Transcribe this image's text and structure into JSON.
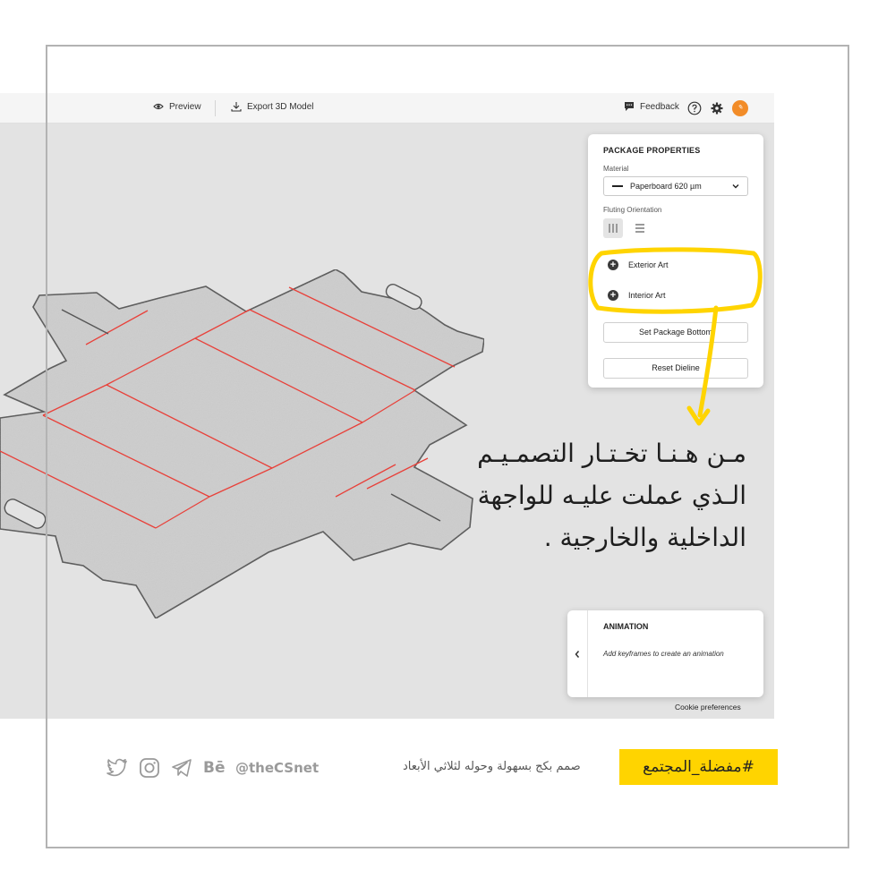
{
  "toolbar": {
    "preview_label": "Preview",
    "export_label": "Export 3D Model",
    "feedback_label": "Feedback"
  },
  "package_properties": {
    "title": "PACKAGE PROPERTIES",
    "material_label": "Material",
    "material_value": "Paperboard 620 µm",
    "fluting_label": "Fluting Orientation",
    "exterior_art_label": "Exterior Art",
    "interior_art_label": "Interior Art",
    "set_bottom_label": "Set Package Bottom",
    "reset_dieline_label": "Reset Dieline"
  },
  "animation": {
    "title": "ANIMATION",
    "description": "Add keyframes to create an animation"
  },
  "cookie_label": "Cookie preferences",
  "annotation": {
    "line1": "مـن هـنـا تخـتـار التصمـيـم",
    "line2": "الـذي عملت عليـه للواجهة",
    "line3": "الداخلية والخارجية ."
  },
  "footer": {
    "handle": "@theCSnet",
    "subtitle": "صمم بكج بسهولة وحوله لثلاثي الأبعاد",
    "hashtag": "#مفضلة_المجتمع",
    "behance_glyph": "Bē"
  },
  "colors": {
    "highlight_yellow": "#ffd400",
    "avatar_orange": "#f28c28",
    "dieline_gray": "#c8c8c8",
    "fold_red": "#e8413a"
  },
  "icons": [
    "eye-icon",
    "download-icon",
    "feedback-icon",
    "help-icon",
    "gear-icon",
    "chevron-down-icon",
    "plus-circle-icon",
    "chevron-left-icon",
    "twitter-icon",
    "instagram-icon",
    "telegram-icon",
    "behance-icon"
  ]
}
